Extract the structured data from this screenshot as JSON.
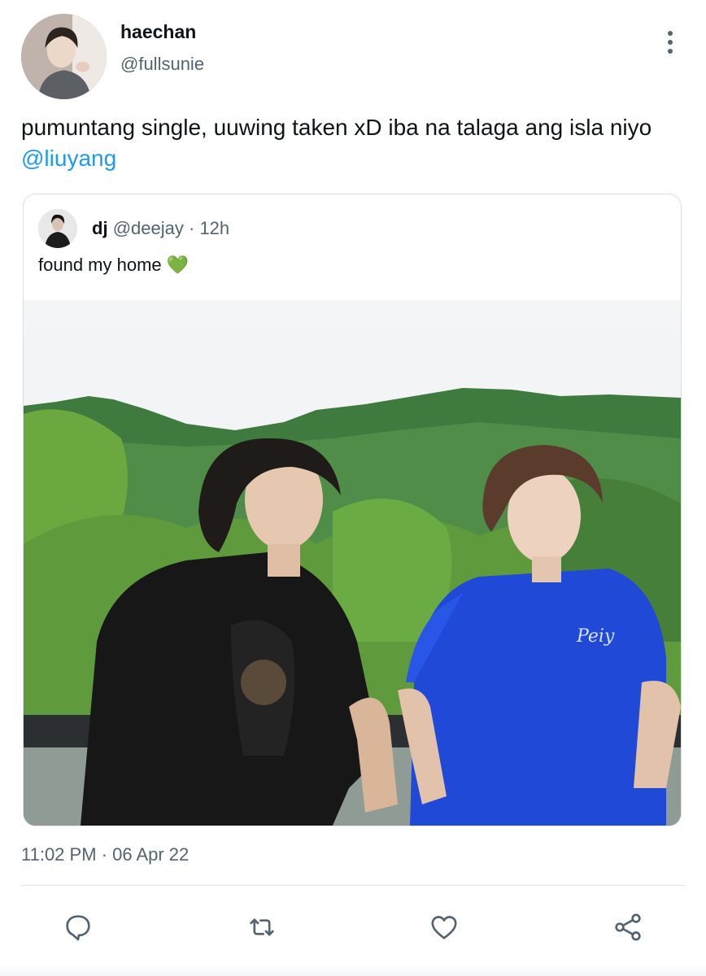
{
  "tweet": {
    "author": {
      "display_name": "haechan",
      "handle": "@fullsunie",
      "avatar_icon": "profile-photo"
    },
    "more_icon": "more-vertical-icon",
    "text": "pumuntang single, uuwing taken xD iba na talaga ang isla niyo ",
    "mention": "@liuyang",
    "timestamp": "11:02 PM · 06 Apr 22"
  },
  "quote": {
    "author": {
      "display_name": "dj",
      "handle": "@deejay",
      "separator": "·",
      "time": "12h"
    },
    "text": "found my home ",
    "emoji": "💚"
  },
  "actions": {
    "reply_icon": "reply-icon",
    "retweet_icon": "retweet-icon",
    "like_icon": "heart-icon",
    "share_icon": "share-icon"
  },
  "colors": {
    "text_primary": "#0f1419",
    "text_secondary": "#536471",
    "link": "#1d9bf0",
    "border": "#dcdfe2"
  }
}
